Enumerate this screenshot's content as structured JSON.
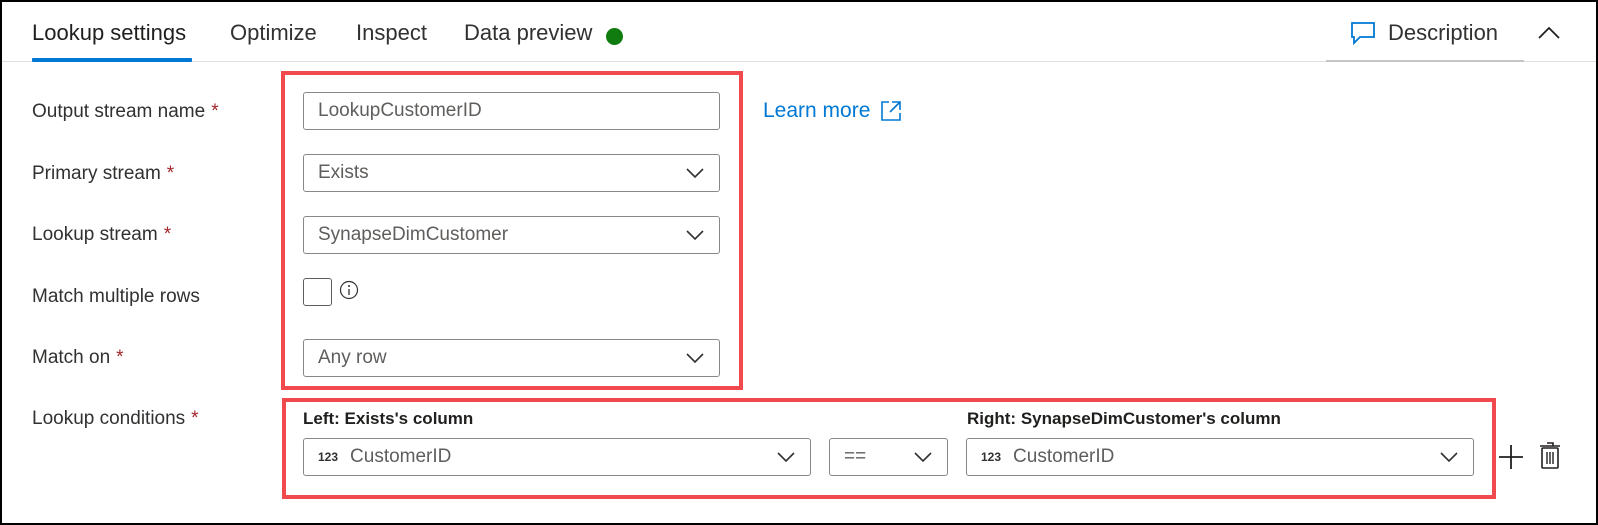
{
  "tabs": [
    {
      "label": "Lookup settings",
      "active": true
    },
    {
      "label": "Optimize",
      "active": false
    },
    {
      "label": "Inspect",
      "active": false
    },
    {
      "label": "Data preview",
      "active": false,
      "status": "ready"
    }
  ],
  "header": {
    "description_label": "Description",
    "description_icon": "comment-icon",
    "collapse_icon": "chevron-up-icon",
    "status_dot_color": "#107c10",
    "accent_color": "#0078d4"
  },
  "form": {
    "required_marker": "*",
    "output_stream_name": {
      "label": "Output stream name",
      "value": "LookupCustomerID"
    },
    "learn_more": {
      "label": "Learn more",
      "icon": "open-in-new-window-icon"
    },
    "primary_stream": {
      "label": "Primary stream",
      "value": "Exists"
    },
    "lookup_stream": {
      "label": "Lookup stream",
      "value": "SynapseDimCustomer"
    },
    "match_multiple_rows": {
      "label": "Match multiple rows",
      "checked": false,
      "info_icon": "info-icon"
    },
    "match_on": {
      "label": "Match on",
      "value": "Any row"
    },
    "lookup_conditions": {
      "label": "Lookup conditions",
      "left_header": "Left: Exists's column",
      "right_header": "Right: SynapseDimCustomer's column",
      "rows": [
        {
          "left_type": "123",
          "left_value": "CustomerID",
          "operator": "==",
          "right_type": "123",
          "right_value": "CustomerID"
        }
      ],
      "add_icon": "plus-icon",
      "delete_icon": "trash-icon"
    }
  },
  "highlight_color": "#f04a4f"
}
